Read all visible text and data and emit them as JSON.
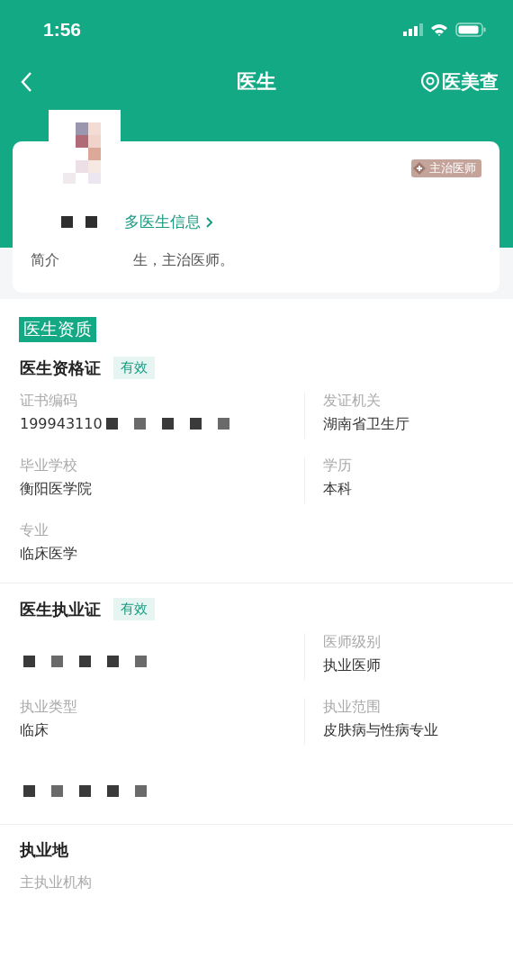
{
  "status_bar": {
    "time": "1:56"
  },
  "nav": {
    "title": "医生",
    "action": "医美查"
  },
  "profile": {
    "badge": "主治医师",
    "more_link": "多医生信息",
    "intro_label": "简介",
    "intro_tail": "生，主治医师。"
  },
  "section_tag": "医生资质",
  "certificates": [
    {
      "title": "医生资格证",
      "status": "有效",
      "valid": true,
      "fields": [
        {
          "label": "证书编码",
          "value": "199943110",
          "redacted": true
        },
        {
          "label": "发证机关",
          "value": "湖南省卫生厅"
        },
        {
          "label": "毕业学校",
          "value": "衡阳医学院"
        },
        {
          "label": "学历",
          "value": "本科"
        },
        {
          "label": "专业",
          "value": "临床医学"
        }
      ]
    },
    {
      "title": "医生执业证",
      "status": "有效",
      "valid": true,
      "fields": [
        {
          "redacted": true
        },
        {
          "label": "医师级别",
          "value": "执业医师"
        },
        {
          "label": "执业类型",
          "value": "临床"
        },
        {
          "label": "执业范围",
          "value": "皮肤病与性病专业"
        },
        {
          "redacted": true
        }
      ]
    }
  ],
  "practice": {
    "title": "执业地",
    "label": "主执业机构"
  }
}
